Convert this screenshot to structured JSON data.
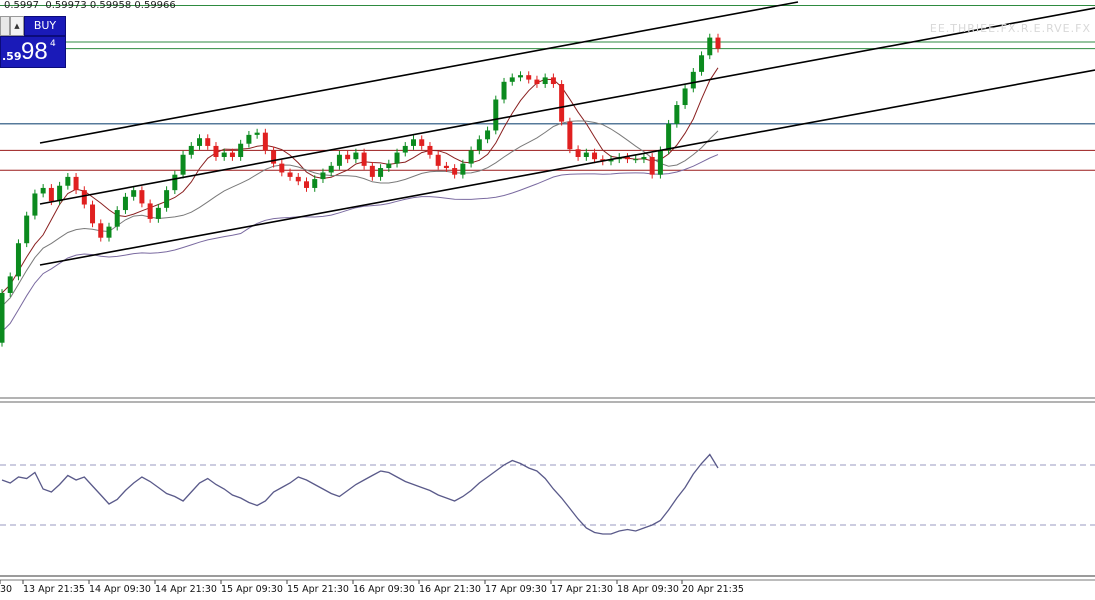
{
  "ohlc": {
    "text": "0.5997  0.59973 0.59958 0.59966"
  },
  "trade_panel": {
    "buy_label": "BUY",
    "price_small": ".59",
    "price_big": "98",
    "price_sup": "4"
  },
  "watermark": {
    "text": "EE.THRIEE.FX.R.E.RVE.FX"
  },
  "colors": {
    "up": "#0b8a1e",
    "down": "#e02020",
    "channel": "#000000",
    "ma1": "#8a2020",
    "ma2": "#7a7a7a",
    "ma3": "#7a6aa0",
    "support_blue": "#1f4f7a",
    "support_red": "#9a1a1a",
    "top_green": "#2e8b40",
    "rsi": "#5a5a8a",
    "rsi_level": "#9a9ac0"
  },
  "chart_data": [
    {
      "type": "candlestick",
      "title": "",
      "x_tick_labels": [
        "13 Apr 21:35",
        "14 Apr 09:30",
        "14 Apr 21:30",
        "15 Apr 09:30",
        "15 Apr 21:30",
        "16 Apr 09:30",
        "16 Apr 21:30",
        "17 Apr 09:30",
        "17 Apr 21:30",
        "18 Apr 09:30",
        "20 Apr 21:35"
      ],
      "x_tick_first_partial": "30",
      "price_levels": {
        "top_green": [
          0.60005,
          0.59972,
          0.59966
        ],
        "blue": 0.59898,
        "red": [
          0.59874,
          0.59856
        ]
      },
      "close_path": [
        [
          0.59745,
          0.597
        ],
        [
          0.5976,
          0.59745
        ],
        [
          0.5979,
          0.5976
        ],
        [
          0.59815,
          0.5979
        ],
        [
          0.59835,
          0.59815
        ],
        [
          0.5984,
          0.59835
        ],
        [
          0.59828,
          0.5984
        ],
        [
          0.59842,
          0.59828
        ],
        [
          0.5985,
          0.59842
        ],
        [
          0.59838,
          0.5985
        ],
        [
          0.59825,
          0.59838
        ],
        [
          0.59808,
          0.59825
        ],
        [
          0.59795,
          0.59808
        ],
        [
          0.59805,
          0.59795
        ],
        [
          0.5982,
          0.59805
        ],
        [
          0.59832,
          0.5982
        ],
        [
          0.59838,
          0.59832
        ],
        [
          0.59826,
          0.59838
        ],
        [
          0.59812,
          0.59826
        ],
        [
          0.59822,
          0.59812
        ],
        [
          0.59838,
          0.59822
        ],
        [
          0.59852,
          0.59838
        ],
        [
          0.5987,
          0.59852
        ],
        [
          0.59878,
          0.5987
        ],
        [
          0.59885,
          0.59878
        ],
        [
          0.59878,
          0.59885
        ],
        [
          0.59868,
          0.59878
        ],
        [
          0.59872,
          0.59868
        ],
        [
          0.59868,
          0.59872
        ],
        [
          0.5988,
          0.59868
        ],
        [
          0.59888,
          0.5988
        ],
        [
          0.5989,
          0.59888
        ],
        [
          0.59874,
          0.5989
        ],
        [
          0.59862,
          0.59874
        ],
        [
          0.59854,
          0.59862
        ],
        [
          0.5985,
          0.59854
        ],
        [
          0.59846,
          0.5985
        ],
        [
          0.5984,
          0.59846
        ],
        [
          0.59848,
          0.5984
        ],
        [
          0.59854,
          0.59848
        ],
        [
          0.5986,
          0.59854
        ],
        [
          0.5987,
          0.5986
        ],
        [
          0.59866,
          0.5987
        ],
        [
          0.59872,
          0.59866
        ],
        [
          0.5986,
          0.59872
        ],
        [
          0.5985,
          0.5986
        ],
        [
          0.59858,
          0.5985
        ],
        [
          0.59862,
          0.59858
        ],
        [
          0.59872,
          0.59862
        ],
        [
          0.59878,
          0.59872
        ],
        [
          0.59884,
          0.59878
        ],
        [
          0.59878,
          0.59884
        ],
        [
          0.5987,
          0.59878
        ],
        [
          0.5986,
          0.5987
        ],
        [
          0.59858,
          0.5986
        ],
        [
          0.59852,
          0.59858
        ],
        [
          0.59862,
          0.59852
        ],
        [
          0.59874,
          0.59862
        ],
        [
          0.59884,
          0.59874
        ],
        [
          0.59892,
          0.59884
        ],
        [
          0.5992,
          0.59892
        ],
        [
          0.59936,
          0.5992
        ],
        [
          0.5994,
          0.59936
        ],
        [
          0.59942,
          0.5994
        ],
        [
          0.59938,
          0.59942
        ],
        [
          0.59934,
          0.59938
        ],
        [
          0.5994,
          0.59934
        ],
        [
          0.59934,
          0.5994
        ],
        [
          0.599,
          0.59934
        ],
        [
          0.59875,
          0.599
        ],
        [
          0.59868,
          0.59875
        ],
        [
          0.59872,
          0.59868
        ],
        [
          0.59866,
          0.59872
        ],
        [
          0.59864,
          0.59866
        ],
        [
          0.59866,
          0.59864
        ],
        [
          0.59868,
          0.59866
        ],
        [
          0.59866,
          0.59868
        ],
        [
          0.59866,
          0.59866
        ],
        [
          0.59868,
          0.59866
        ],
        [
          0.59852,
          0.59868
        ],
        [
          0.59874,
          0.59852
        ],
        [
          0.59898,
          0.59874
        ],
        [
          0.59915,
          0.59898
        ],
        [
          0.5993,
          0.59915
        ],
        [
          0.59945,
          0.5993
        ],
        [
          0.5996,
          0.59945
        ],
        [
          0.59976,
          0.5996
        ],
        [
          0.59966,
          0.59976
        ]
      ]
    },
    {
      "type": "line",
      "title": "",
      "levels": [
        70,
        30
      ],
      "series": [
        {
          "values": [
            60,
            58,
            62,
            61,
            65,
            54,
            52,
            57,
            63,
            60,
            62,
            56,
            50,
            44,
            47,
            53,
            58,
            62,
            59,
            55,
            51,
            49,
            46,
            52,
            58,
            61,
            57,
            54,
            50,
            48,
            45,
            43,
            46,
            52,
            55,
            58,
            62,
            60,
            57,
            54,
            51,
            49,
            53,
            57,
            60,
            63,
            66,
            65,
            62,
            59,
            57,
            55,
            53,
            50,
            48,
            46,
            49,
            53,
            58,
            62,
            66,
            70,
            73,
            71,
            68,
            66,
            61,
            54,
            48,
            41,
            34,
            28,
            25,
            24,
            24,
            26,
            27,
            26,
            28,
            30,
            33,
            40,
            48,
            55,
            64,
            71,
            77,
            68
          ]
        }
      ]
    }
  ]
}
